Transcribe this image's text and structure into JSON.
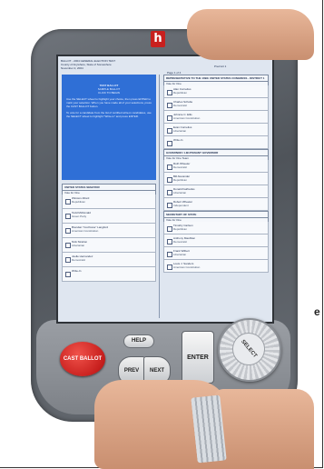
{
  "device": {
    "logo": "h",
    "side_mark": "e"
  },
  "ballot": {
    "election_line": "BALLOT - 2004 GENERAL ELECTION TEST",
    "county_line": "County of Anywhere, State of Somewhere",
    "date_line": "November 2, 2004",
    "precinct": "Precinct 1",
    "page_indicator": "Page 1 of 4",
    "instructions": {
      "lead": "TEST BALLOT",
      "lines": [
        "SAMPLE BALLOT",
        "CLICK TO BEGIN"
      ],
      "p1": "Use the SELECT wheel to highlight your choice, then press ENTER to mark your selection. When you have made all of your selections, press the CAST BALLOT button.",
      "p2": "To vote for a candidate from the list of certified write-in candidates, use the SELECT wheel to highlight \"Write-in\" and press ENTER."
    },
    "senate": {
      "title": "UNITED STATES SENATOR",
      "subtitle": "Vote for One",
      "candidates": [
        {
          "name": "Winston Alford",
          "party": "Republican"
        },
        {
          "name": "Todd McDonald",
          "party": "Green Party"
        },
        {
          "name": "Brendan \"Cochrane\" Langford",
          "party": "American Constitution"
        },
        {
          "name": "Nick Stratton",
          "party": "Libertarian"
        },
        {
          "name": "Joelle Hernandez",
          "party": "Democratic"
        },
        {
          "name": "Write-In",
          "party": ""
        }
      ]
    },
    "representative": {
      "title": "REPRESENTATIVE TO THE 109th UNITED STATES CONGRESS - DISTRICT 1",
      "subtitle": "Vote for One",
      "candidates": [
        {
          "name": "Alan Cornelius",
          "party": "Republican"
        },
        {
          "name": "Charles Schulte",
          "party": "Democratic"
        },
        {
          "name": "Johnnie C. Ellis",
          "party": "American Constitution"
        },
        {
          "name": "Evan Cornelius",
          "party": "Libertarian"
        },
        {
          "name": "Write-In",
          "party": ""
        }
      ]
    },
    "governor": {
      "title": "GOVERNOR / LIEUTENANT GOVERNOR",
      "subtitle": "Vote for One Team",
      "candidates": [
        {
          "name": "Ruth Wheeler",
          "party": "Democratic"
        },
        {
          "name": "Bill Alexander",
          "party": "Republican"
        },
        {
          "name": "Donald Fairbanks",
          "party": "Libertarian"
        },
        {
          "name": "Robert Wheeler",
          "party": "Independent"
        }
      ]
    },
    "secretary": {
      "title": "SECRETARY OF STATE",
      "subtitle": "Vote for One",
      "candidates": [
        {
          "name": "Timothy Carlson",
          "party": "Republican"
        },
        {
          "name": "Anthony MacAllen",
          "party": "Democratic"
        },
        {
          "name": "Frank Wilbert",
          "party": "Libertarian"
        },
        {
          "name": "Louis J. Sanders",
          "party": "American Constitution"
        }
      ]
    }
  },
  "controls": {
    "cast_ballot": "CAST BALLOT",
    "help": "HELP",
    "prev": "PREV",
    "next": "NEXT",
    "enter": "ENTER",
    "select": "SELECT"
  }
}
